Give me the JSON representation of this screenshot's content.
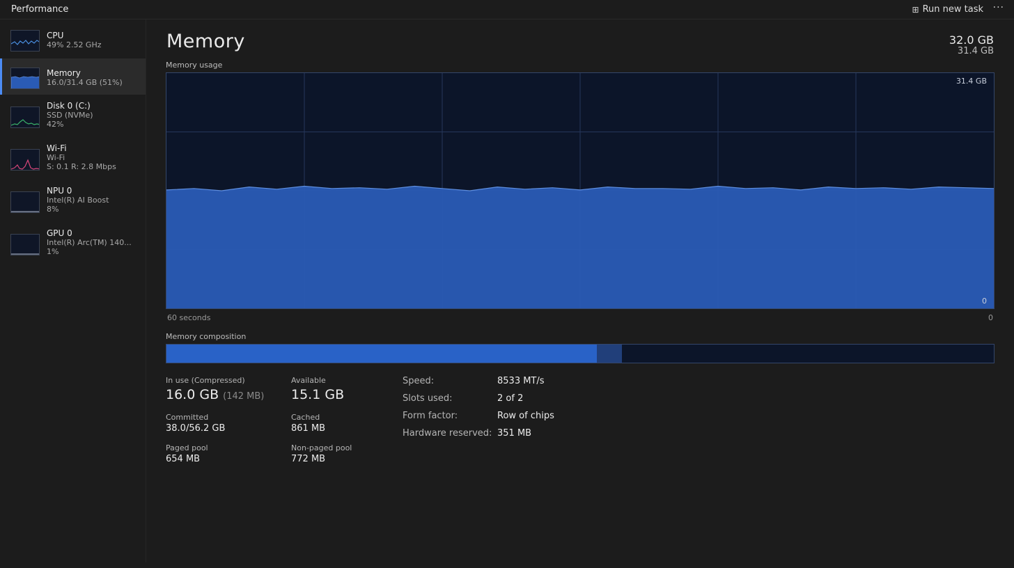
{
  "header": {
    "title": "Performance",
    "run_task_label": "Run new task",
    "more_label": "···"
  },
  "sidebar": {
    "items": [
      {
        "name": "CPU",
        "line1": "49% 2.52 GHz",
        "line2": ""
      },
      {
        "name": "Memory",
        "line1": "16.0/31.4 GB (51%)",
        "line2": ""
      },
      {
        "name": "Disk 0 (C:)",
        "line1": "SSD (NVMe)",
        "line2": "42%"
      },
      {
        "name": "Wi-Fi",
        "line1": "Wi-Fi",
        "line2": "S: 0.1 R: 2.8 Mbps"
      },
      {
        "name": "NPU 0",
        "line1": "Intel(R) AI Boost",
        "line2": "8%"
      },
      {
        "name": "GPU 0",
        "line1": "Intel(R) Arc(TM) 140...",
        "line2": "1%"
      }
    ],
    "active_item": "Memory"
  },
  "main": {
    "title": "Memory",
    "total": "32.0 GB",
    "total_sub": "31.4 GB",
    "usage_label": "Memory usage",
    "graph_max": "31.4 GB",
    "graph_min": "0",
    "axis_left": "60 seconds",
    "axis_right": "0",
    "composition_label": "Memory composition",
    "composition": {
      "in_use_fraction": 0.52,
      "modified_fraction": 0.03
    }
  },
  "stats": {
    "in_use_label": "In use (Compressed)",
    "in_use_value": "16.0 GB",
    "in_use_compressed": "(142 MB)",
    "available_label": "Available",
    "available_value": "15.1 GB",
    "committed_label": "Committed",
    "committed_value": "38.0/56.2 GB",
    "cached_label": "Cached",
    "cached_value": "861 MB",
    "paged_label": "Paged pool",
    "paged_value": "654 MB",
    "nonpaged_label": "Non-paged pool",
    "nonpaged_value": "772 MB"
  },
  "specs": {
    "speed_label": "Speed:",
    "speed_value": "8533 MT/s",
    "slots_label": "Slots used:",
    "slots_value": "2 of 2",
    "form_label": "Form factor:",
    "form_value": "Row of chips",
    "reserved_label": "Hardware reserved:",
    "reserved_value": "351 MB"
  },
  "colors": {
    "accent": "#4c8cf5",
    "memory_fill": "#2a5bb5",
    "cpu_line": "#4a90e2",
    "disk_line": "#3bb56a",
    "wifi_line": "#d9477a",
    "graph_bg": "#0c1529"
  },
  "chart_data": {
    "type": "area",
    "title": "Memory usage",
    "xlabel": "",
    "ylabel": "",
    "x_range_label": [
      "60 seconds",
      "0"
    ],
    "ylim": [
      0,
      31.4
    ],
    "values": [
      15.8,
      16.0,
      15.7,
      16.2,
      15.9,
      16.3,
      16.0,
      16.1,
      15.9,
      16.3,
      16.0,
      15.7,
      16.2,
      15.9,
      16.1,
      15.8,
      16.2,
      16.0,
      16.0,
      15.9,
      16.3,
      16.0,
      16.1,
      15.8,
      16.2,
      16.0,
      16.1,
      15.9,
      16.2,
      16.1,
      16.0
    ]
  }
}
